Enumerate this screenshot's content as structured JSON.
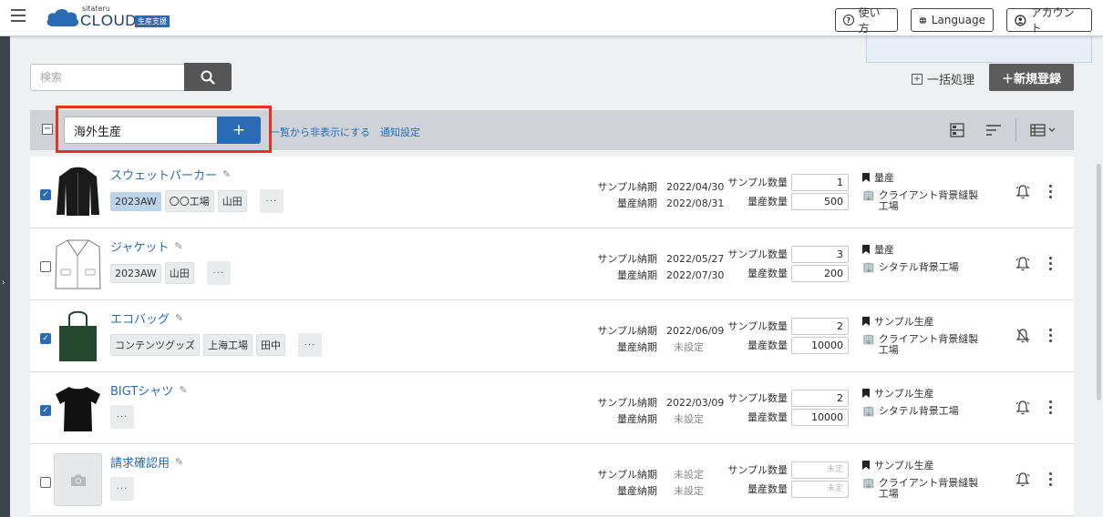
{
  "header": {
    "logo_small": "sitateru",
    "logo_main": "CLOUD",
    "logo_badge": "生産支援",
    "help_label": "使い方",
    "language_label": "Language",
    "account_label": "アカウント"
  },
  "search": {
    "placeholder": "検索"
  },
  "toolbar": {
    "bulk_label": "一括処理",
    "new_label": "＋新規登録"
  },
  "filter": {
    "tag_value": "海外生産",
    "add_label": "+",
    "hide_label": "一覧から非表示にする",
    "notify_label": "通知設定"
  },
  "labels": {
    "sample_due": "サンプル納期",
    "mass_due": "量産納期",
    "sample_qty": "サンプル数量",
    "mass_qty": "量産数量"
  },
  "items": [
    {
      "name": "スウェットパーカー",
      "checked": true,
      "tags": [
        "2023AW",
        "〇〇工場",
        "山田"
      ],
      "sample_due": "2022/04/30",
      "mass_due": "2022/08/31",
      "sample_qty": "1",
      "mass_qty": "500",
      "phase": "量産",
      "factory": "クライアント背景縫製工場",
      "bell": "on"
    },
    {
      "name": "ジャケット",
      "checked": false,
      "tags": [
        "2023AW",
        "山田"
      ],
      "sample_due": "2022/05/27",
      "mass_due": "2022/07/30",
      "sample_qty": "3",
      "mass_qty": "200",
      "phase": "量産",
      "factory": "シタテル背景工場",
      "bell": "on"
    },
    {
      "name": "エコバッグ",
      "checked": true,
      "tags": [
        "コンテンツグッズ",
        "上海工場",
        "田中"
      ],
      "sample_due": "2022/06/09",
      "mass_due": "未設定",
      "sample_qty": "2",
      "mass_qty": "10000",
      "phase": "サンプル生産",
      "factory": "クライアント背景縫製工場",
      "bell": "off"
    },
    {
      "name": "BIGTシャツ",
      "checked": true,
      "tags": [],
      "sample_due": "2022/03/09",
      "mass_due": "未設定",
      "sample_qty": "2",
      "mass_qty": "10000",
      "phase": "サンプル生産",
      "factory": "シタテル背景工場",
      "bell": "on"
    },
    {
      "name": "請求確認用",
      "checked": false,
      "tags": [],
      "sample_due": "未設定",
      "mass_due": "未設定",
      "sample_qty": "未定",
      "mass_qty": "未定",
      "phase": "サンプル生産",
      "factory": "クライアント背景縫製工場",
      "bell": "on"
    }
  ],
  "colors": {
    "accent": "#2a6bb3",
    "highlight": "#e8321f"
  }
}
